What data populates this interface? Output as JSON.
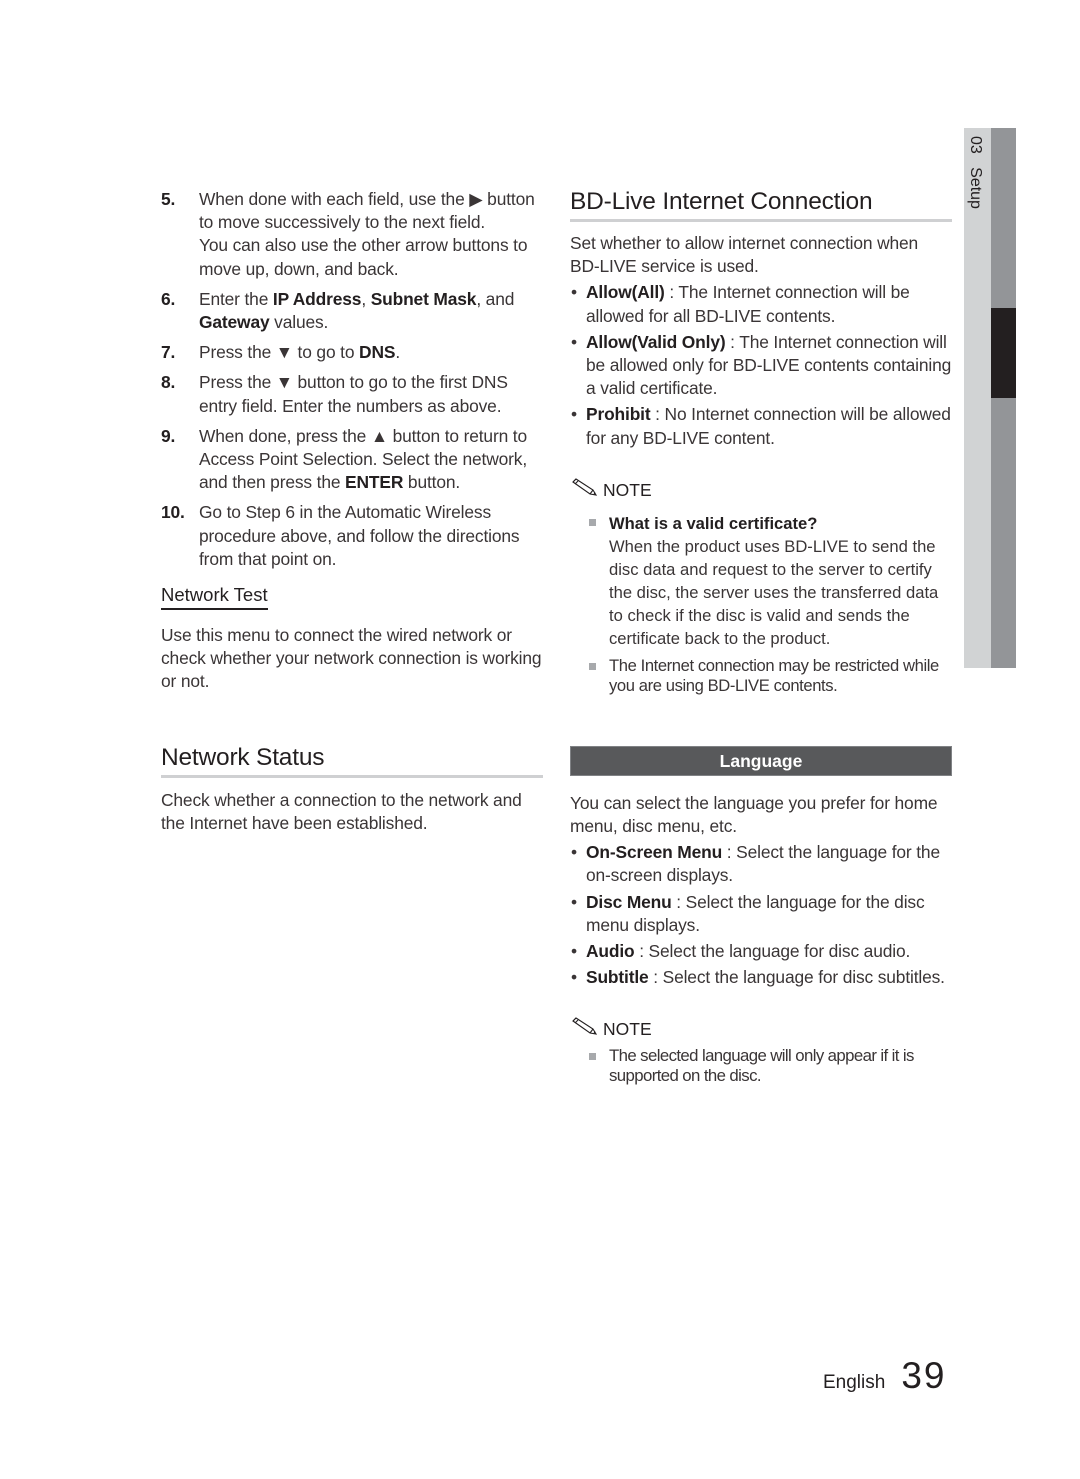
{
  "left_column": {
    "steps": [
      {
        "num": "5.",
        "parts": [
          {
            "t": "When done with each field, use the ▶ button to move successively to the next field.",
            "b": false
          }
        ],
        "extra": "You can also use the other arrow buttons to move up, down, and back."
      },
      {
        "num": "6.",
        "parts": [
          {
            "t": "Enter the ",
            "b": false
          },
          {
            "t": "IP Address",
            "b": true
          },
          {
            "t": ", ",
            "b": false
          },
          {
            "t": "Subnet Mask",
            "b": true
          },
          {
            "t": ", and ",
            "b": false
          },
          {
            "t": "Gateway",
            "b": true
          },
          {
            "t": " values.",
            "b": false
          }
        ]
      },
      {
        "num": "7.",
        "parts": [
          {
            "t": "Press the ▼ to go to ",
            "b": false
          },
          {
            "t": "DNS",
            "b": true
          },
          {
            "t": ".",
            "b": false
          }
        ]
      },
      {
        "num": "8.",
        "parts": [
          {
            "t": "Press the ▼ button to go to the first DNS entry field. Enter the numbers as above.",
            "b": false
          }
        ]
      },
      {
        "num": "9.",
        "parts": [
          {
            "t": "When done, press the ▲ button to return to Access Point Selection. Select the network, and then press the ",
            "b": false
          },
          {
            "t": "ENTER",
            "b": true
          },
          {
            "t": " button.",
            "b": false
          }
        ]
      },
      {
        "num": "10.",
        "parts": [
          {
            "t": "Go to Step 6 in the Automatic Wireless procedure above, and follow the directions from that point on.",
            "b": false
          }
        ]
      }
    ],
    "network_test": {
      "heading": "Network Test",
      "body": "Use this menu to connect the wired network or check whether your network connection is working or not."
    },
    "network_status": {
      "heading": "Network Status",
      "body": "Check whether a connection to the network and the Internet have been established."
    }
  },
  "right_column": {
    "bd_live": {
      "heading": "BD-Live Internet Connection",
      "intro": "Set whether to allow internet connection when BD-LIVE service is used.",
      "options": [
        {
          "term": "Allow(All)",
          "desc": " : The Internet connection will be allowed for all BD-LIVE contents."
        },
        {
          "term": "Allow(Valid Only)",
          "desc": " : The Internet connection will be allowed only for BD-LIVE contents containing a valid certificate."
        },
        {
          "term": "Prohibit",
          "desc": " : No Internet connection will be allowed for any BD-LIVE content."
        }
      ],
      "note": {
        "label": "NOTE",
        "items": [
          {
            "title": "What is a valid certificate?",
            "text": "When the product uses BD-LIVE to send the disc data and request to the server to certify the disc, the server uses the transferred data to check if the disc is valid and sends the certificate back to the product."
          },
          {
            "title": "",
            "text": "The Internet connection may be restricted while you are using BD-LIVE contents."
          }
        ]
      }
    },
    "language": {
      "heading": "Language",
      "intro": "You can select the language you prefer for home menu, disc menu, etc.",
      "options": [
        {
          "term": "On-Screen Menu",
          "desc": " : Select the language for the on-screen displays."
        },
        {
          "term": "Disc Menu",
          "desc": " : Select the language for the disc menu displays."
        },
        {
          "term": "Audio",
          "desc": " : Select the language for disc audio."
        },
        {
          "term": "Subtitle",
          "desc": " : Select the language for disc subtitles."
        }
      ],
      "note": {
        "label": "NOTE",
        "items": [
          {
            "title": "",
            "text": "The selected language will only appear if it is supported on the disc."
          }
        ]
      }
    }
  },
  "side_tab": {
    "chapter": "03",
    "label": "Setup"
  },
  "footer": {
    "language": "English",
    "page_number": "39"
  },
  "colors": {
    "text": "#231f20",
    "body": "#3a3536",
    "bar": "#58595b",
    "rule": "#cfd0d2",
    "tab_light": "#d1d3d4",
    "tab_dark": "#939598"
  }
}
